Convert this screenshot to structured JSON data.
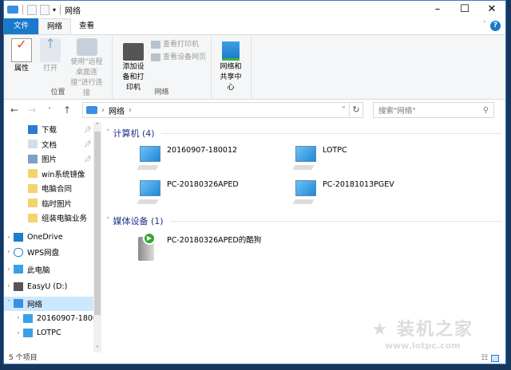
{
  "window": {
    "title": "网络"
  },
  "ribbon": {
    "tabs": [
      "文件",
      "网络",
      "查看"
    ],
    "groups": [
      {
        "label": "位置",
        "buttons": [
          "属性",
          "打开",
          "使用\"远程桌面连接\"进行连接"
        ]
      },
      {
        "label": "网络",
        "buttons": [
          "添加设备和打印机"
        ],
        "small": [
          "查看打印机",
          "查看设备网页"
        ]
      },
      {
        "label": "",
        "buttons": [
          "网络和共享中心"
        ]
      }
    ]
  },
  "address": {
    "path": "网络",
    "search_placeholder": "搜索\"网络\""
  },
  "nav": [
    {
      "label": "下载",
      "pinned": true
    },
    {
      "label": "文档",
      "pinned": true
    },
    {
      "label": "图片",
      "pinned": true
    },
    {
      "label": "win系统镜像"
    },
    {
      "label": "电脑合同"
    },
    {
      "label": "临时图片"
    },
    {
      "label": "组装电脑业务"
    },
    {
      "label": "OneDrive"
    },
    {
      "label": "WPS网盘"
    },
    {
      "label": "此电脑"
    },
    {
      "label": "EasyU (D:)"
    },
    {
      "label": "网络",
      "selected": true
    },
    {
      "label": "20160907-1800"
    },
    {
      "label": "LOTPC"
    }
  ],
  "content": {
    "groups": [
      {
        "title": "计算机 (4)",
        "items": [
          "20160907-180012",
          "LOTPC",
          "PC-20180326APED",
          "PC-20181013PGEV"
        ]
      },
      {
        "title": "媒体设备 (1)",
        "items": [
          "PC-20180326APED的酷狗"
        ]
      }
    ]
  },
  "status": "5 个项目",
  "watermark": {
    "title": "装机之家",
    "url": "www.lotpc.com"
  }
}
